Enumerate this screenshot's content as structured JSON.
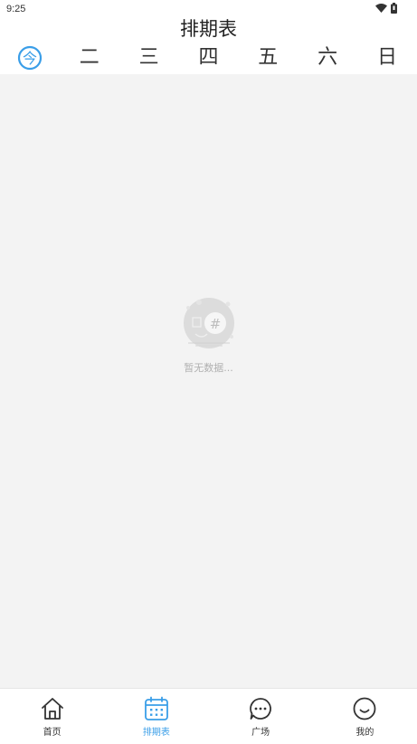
{
  "status": {
    "time": "9:25"
  },
  "header": {
    "title": "排期表"
  },
  "week": {
    "days": [
      "今",
      "二",
      "三",
      "四",
      "五",
      "六",
      "日"
    ],
    "selected_index": 0
  },
  "content": {
    "empty_text": "暂无数据..."
  },
  "tabs": [
    {
      "label": "首页",
      "icon": "home-icon"
    },
    {
      "label": "排期表",
      "icon": "calendar-icon"
    },
    {
      "label": "广场",
      "icon": "chat-bubble-icon"
    },
    {
      "label": "我的",
      "icon": "smiley-icon"
    }
  ],
  "active_tab": 1,
  "colors": {
    "accent": "#3a9ee8",
    "background": "#f3f3f3",
    "text": "#333333"
  }
}
